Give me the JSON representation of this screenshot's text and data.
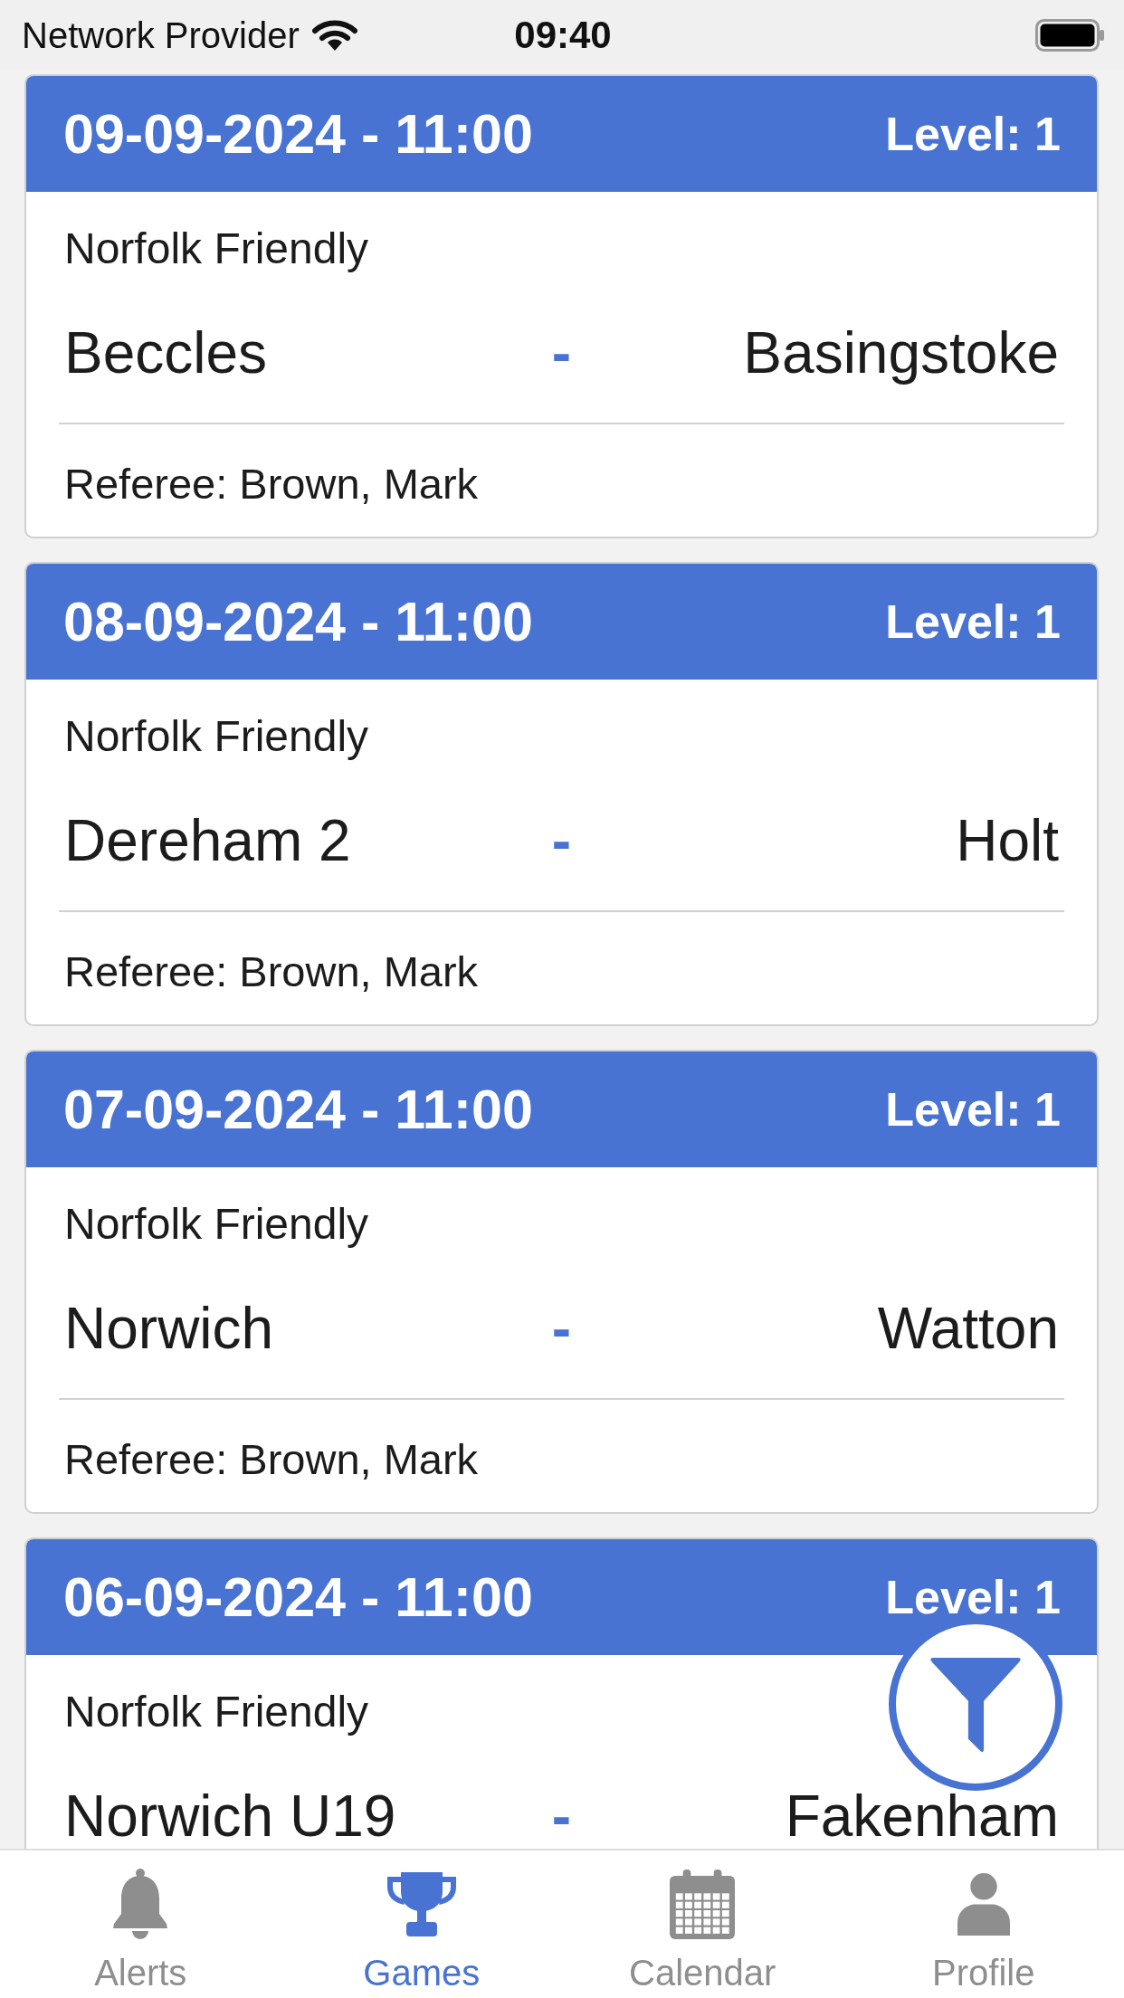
{
  "status_bar": {
    "carrier": "Network Provider",
    "time": "09:40"
  },
  "games": [
    {
      "datetime": "09-09-2024 - 11:00",
      "level_label": "Level: 1",
      "competition": "Norfolk Friendly",
      "home": "Beccles",
      "separator": "-",
      "away": "Basingstoke",
      "referee": "Referee: Brown, Mark"
    },
    {
      "datetime": "08-09-2024 - 11:00",
      "level_label": "Level: 1",
      "competition": "Norfolk Friendly",
      "home": "Dereham 2",
      "separator": "-",
      "away": "Holt",
      "referee": "Referee: Brown, Mark"
    },
    {
      "datetime": "07-09-2024 - 11:00",
      "level_label": "Level: 1",
      "competition": "Norfolk Friendly",
      "home": "Norwich",
      "separator": "-",
      "away": "Watton",
      "referee": "Referee: Brown, Mark"
    },
    {
      "datetime": "06-09-2024 - 11:00",
      "level_label": "Level: 1",
      "competition": "Norfolk Friendly",
      "home": "Norwich U19",
      "separator": "-",
      "away": "Fakenham"
    }
  ],
  "tab_bar": [
    {
      "label": "Alerts",
      "kind": "bell",
      "selected": false
    },
    {
      "label": "Games",
      "kind": "trophy",
      "selected": true
    },
    {
      "label": "Calendar",
      "kind": "calendar",
      "selected": false
    },
    {
      "label": "Profile",
      "kind": "person",
      "selected": false
    }
  ]
}
